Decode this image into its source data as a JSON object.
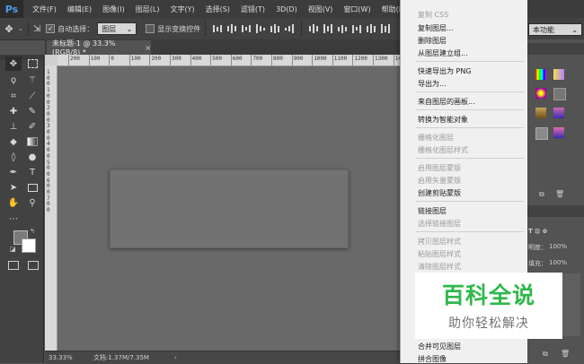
{
  "app": {
    "logo": "Ps"
  },
  "menubar": {
    "items": [
      "文件(F)",
      "编辑(E)",
      "图像(I)",
      "图层(L)",
      "文字(Y)",
      "选择(S)",
      "滤镜(T)",
      "3D(D)",
      "视图(V)",
      "窗口(W)",
      "帮助(H)"
    ]
  },
  "options_bar": {
    "auto_select_label": "自动选择：",
    "auto_select_value": "图层",
    "show_transform_label": "显示变换控件",
    "workspace_value": "本功能"
  },
  "document": {
    "tab_title": "未标题-1 @ 33.3%(RGB/8) *",
    "tab_close": "×"
  },
  "rulers": {
    "top": [
      "200",
      "100",
      "0",
      "100",
      "200",
      "300",
      "400",
      "500",
      "600",
      "700",
      "800",
      "900",
      "1000",
      "1100",
      "1200",
      "1300",
      "1400"
    ],
    "left": [
      "1",
      "0",
      "0",
      "1",
      "0",
      "0",
      "2",
      "0",
      "0",
      "3",
      "0",
      "0",
      "4",
      "0",
      "0",
      "5",
      "0",
      "0",
      "6",
      "0",
      "0",
      "7",
      "0",
      "0"
    ]
  },
  "status": {
    "zoom": "33.33%",
    "doc": "文档:1.37M/7.35M",
    "arrow": "›"
  },
  "context_menu": {
    "items": [
      {
        "label": "复制 CSS",
        "disabled": true
      },
      {
        "label": "复制图层...",
        "disabled": false
      },
      {
        "label": "删除图层",
        "disabled": false
      },
      {
        "label": "从图层建立组...",
        "disabled": false
      },
      {
        "label": "快速导出为 PNG",
        "disabled": false
      },
      {
        "label": "导出为...",
        "disabled": false
      },
      {
        "label": "来自图层的画板...",
        "disabled": false
      },
      {
        "label": "转换为智能对象",
        "disabled": false
      },
      {
        "label": "栅格化图层",
        "disabled": true
      },
      {
        "label": "栅格化图层样式",
        "disabled": true
      },
      {
        "label": "启用图层蒙版",
        "disabled": true
      },
      {
        "label": "启用矢量蒙版",
        "disabled": true
      },
      {
        "label": "创建剪贴蒙版",
        "disabled": false
      },
      {
        "label": "链接图层",
        "disabled": false
      },
      {
        "label": "选择链接图层",
        "disabled": true
      },
      {
        "label": "拷贝图层样式",
        "disabled": true
      },
      {
        "label": "粘贴图层样式",
        "disabled": true
      },
      {
        "label": "清除图层样式",
        "disabled": true
      },
      {
        "label": "合并可见图层",
        "disabled": false
      },
      {
        "label": "拼合图像",
        "disabled": false
      }
    ]
  },
  "right_panel": {
    "opacity_label": "明度：",
    "opacity_value": "100%",
    "fill_label": "填充：",
    "fill_value": "100%"
  },
  "watermark": {
    "title": "百科全说",
    "subtitle": "助你轻松解决"
  },
  "colors": {
    "accent": "#2fb84b",
    "ps_blue": "#4aa0ea",
    "canvas": "#696969",
    "menu_bg": "#f0f0f0"
  }
}
